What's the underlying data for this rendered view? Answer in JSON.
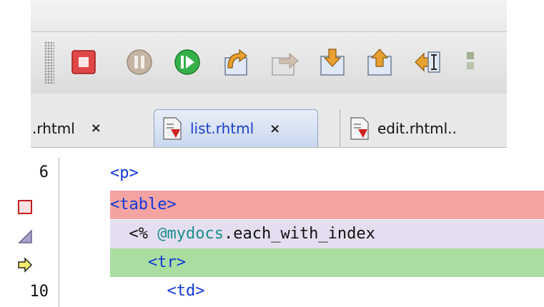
{
  "toolbar": {
    "buttons": [
      {
        "name": "stop",
        "icon": "stop-icon"
      },
      {
        "name": "pause",
        "icon": "pause-icon"
      },
      {
        "name": "continue",
        "icon": "continue-icon"
      },
      {
        "name": "step-over",
        "icon": "step-over-icon"
      },
      {
        "name": "step-over-expression",
        "icon": "step-over-expression-icon"
      },
      {
        "name": "step-into",
        "icon": "step-into-icon"
      },
      {
        "name": "step-out",
        "icon": "step-out-icon"
      },
      {
        "name": "run-to-cursor",
        "icon": "run-to-cursor-icon"
      }
    ]
  },
  "tabs": [
    {
      "label": ".rhtml",
      "close": "×",
      "active": false
    },
    {
      "label": "list.rhtml",
      "close": "×",
      "active": true
    },
    {
      "label": "edit.rhtml..",
      "active": false
    }
  ],
  "editor": {
    "lines": [
      {
        "number": "6",
        "gutter_icon": null,
        "highlight": "none",
        "indent": "",
        "code": [
          {
            "text": "<p>",
            "kind": "tag"
          }
        ]
      },
      {
        "number": "",
        "gutter_icon": "breakpoint-icon",
        "highlight": "red",
        "indent": "",
        "code": [
          {
            "text": "<table>",
            "kind": "tag"
          }
        ]
      },
      {
        "number": "",
        "gutter_icon": "disabled-breakpoint-icon",
        "highlight": "purple",
        "indent": "  ",
        "code": [
          {
            "text": "<% ",
            "kind": "plain"
          },
          {
            "text": "@mydocs",
            "kind": "ivar"
          },
          {
            "text": ".each_with_index",
            "kind": "plain"
          }
        ]
      },
      {
        "number": "",
        "gutter_icon": "program-counter-icon",
        "highlight": "green",
        "indent": "    ",
        "code": [
          {
            "text": "<tr>",
            "kind": "tag"
          }
        ]
      },
      {
        "number": "10",
        "gutter_icon": null,
        "highlight": "none",
        "indent": "      ",
        "code": [
          {
            "text": "<td>",
            "kind": "tag"
          }
        ]
      }
    ]
  },
  "colors": {
    "breakpoint_line": "#f4a3a3",
    "disabled_breakpoint_line": "#e4def0",
    "current_line": "#a9dea0",
    "tag": "#1036d8",
    "instance_variable": "#1a8e8e"
  }
}
